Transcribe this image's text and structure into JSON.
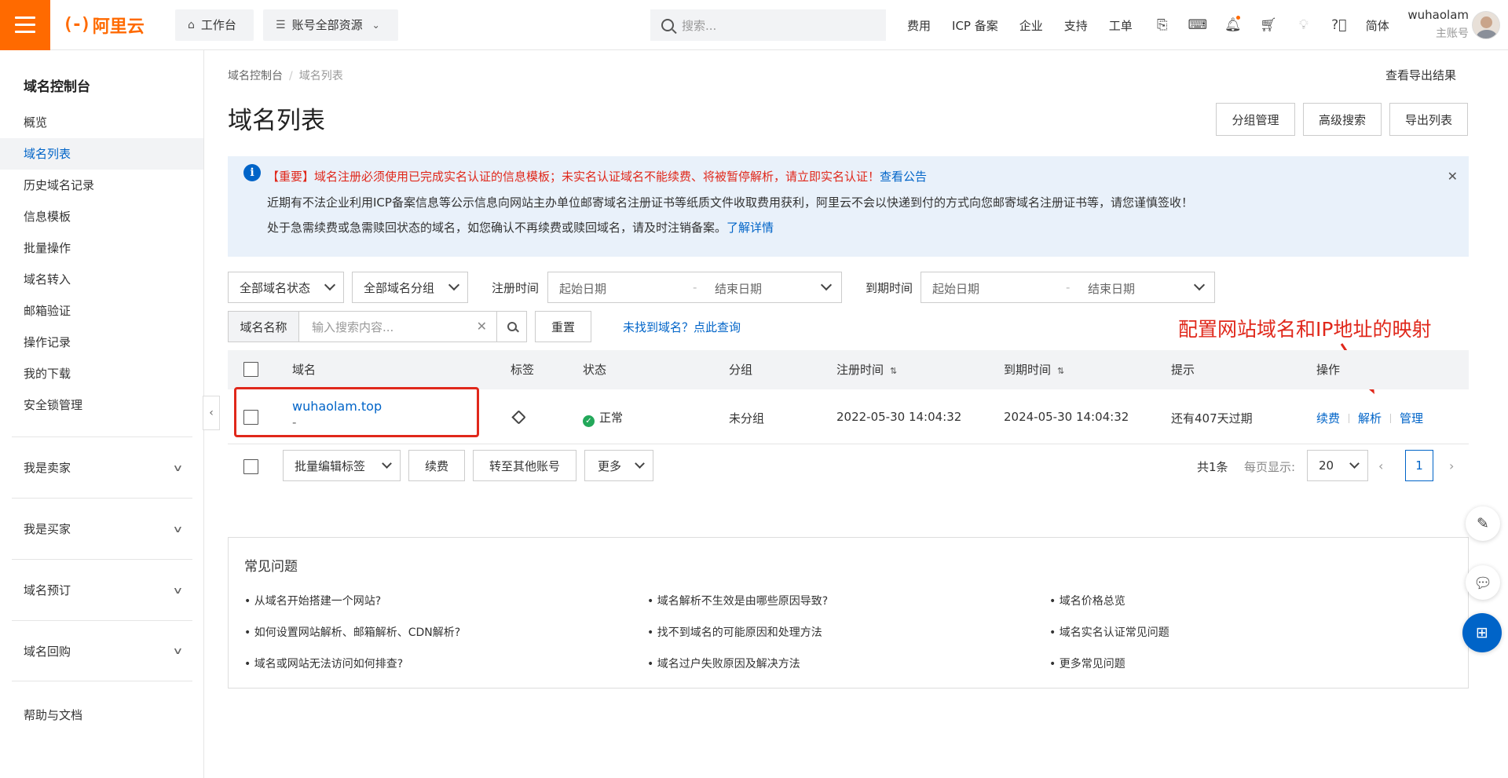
{
  "topbar": {
    "brand_mark": "(-)",
    "brand_name": "阿里云",
    "workbench": "工作台",
    "resources": "账号全部资源",
    "search_placeholder": "搜索...",
    "nav": [
      "费用",
      "ICP 备案",
      "企业",
      "支持",
      "工单"
    ],
    "lang": "简体",
    "user_name": "wuhaolam",
    "user_role": "主账号"
  },
  "sidebar": {
    "title": "域名控制台",
    "items": [
      "概览",
      "域名列表",
      "历史域名记录",
      "信息模板",
      "批量操作",
      "域名转入",
      "邮箱验证",
      "操作记录",
      "我的下载",
      "安全锁管理"
    ],
    "groups": [
      "我是卖家",
      "我是买家",
      "域名预订",
      "域名回购"
    ],
    "help": "帮助与文档"
  },
  "breadcrumb": {
    "root": "域名控制台",
    "current": "域名列表"
  },
  "export_result": "查看导出结果",
  "page_title": "域名列表",
  "header_buttons": {
    "group": "分组管理",
    "advanced": "高级搜索",
    "export": "导出列表"
  },
  "notice": {
    "line1": "【重要】域名注册必须使用已完成实名认证的信息模板；未实名认证域名不能续费、将被暂停解析，请立即实名认证！",
    "line1_link": "查看公告",
    "line2": "近期有不法企业利用ICP备案信息等公示信息向网站主办单位邮寄域名注册证书等纸质文件收取费用获利，阿里云不会以快递到付的方式向您邮寄域名注册证书等，请您谨慎签收！",
    "line3": "处于急需续费或急需赎回状态的域名，如您确认不再续费或赎回域名，请及时注销备案。",
    "line3_link": "了解详情"
  },
  "filters": {
    "status": "全部域名状态",
    "group": "全部域名分组",
    "reg_label": "注册时间",
    "exp_label": "到期时间",
    "start_placeholder": "起始日期",
    "end_placeholder": "结束日期",
    "range_sep": "-",
    "search_tag": "域名名称",
    "search_placeholder": "输入搜索内容...",
    "reset": "重置",
    "not_found_link": "未找到域名？点此查询"
  },
  "annotation": "配置网站域名和IP地址的映射",
  "table": {
    "headers": [
      "域名",
      "标签",
      "状态",
      "分组",
      "注册时间",
      "到期时间",
      "提示",
      "操作"
    ],
    "rows": [
      {
        "domain": "wuhaolam.top",
        "sub": "-",
        "status": "正常",
        "group": "未分组",
        "reg": "2022-05-30 14:04:32",
        "exp": "2024-05-30 14:04:32",
        "tip": "还有407天过期",
        "ops": [
          "续费",
          "解析",
          "管理"
        ]
      }
    ]
  },
  "bottom": {
    "batch_tag": "批量编辑标签",
    "renew": "续费",
    "transfer": "转至其他账号",
    "more": "更多",
    "total": "共1条",
    "page_size_label": "每页显示:",
    "page_size": "20",
    "current_page": "1"
  },
  "faq": {
    "title": "常见问题",
    "items": [
      "• 从域名开始搭建一个网站?",
      "• 域名解析不生效是由哪些原因导致?",
      "• 域名价格总览",
      "• 如何设置网站解析、邮箱解析、CDN解析?",
      "• 找不到域名的可能原因和处理方法",
      "• 域名实名认证常见问题",
      "• 域名或网站无法访问如何排查?",
      "• 域名过户失败原因及解决方法",
      "• 更多常见问题"
    ]
  },
  "colors": {
    "accent": "#ff6a00",
    "link": "#0064c8",
    "alert": "#e0281b",
    "success": "#23a85a"
  }
}
